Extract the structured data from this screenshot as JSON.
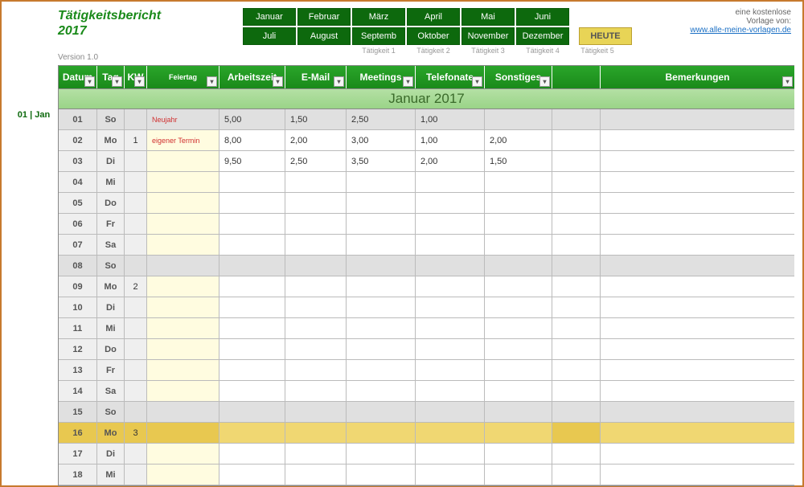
{
  "title_line1": "Tätigkeitsbericht",
  "title_line2": "2017",
  "version": "Version 1.0",
  "months_row1": [
    "Januar",
    "Februar",
    "März",
    "April",
    "Mai",
    "Juni"
  ],
  "months_row2": [
    "Juli",
    "August",
    "Septemb",
    "Oktober",
    "November",
    "Dezember"
  ],
  "heute_label": "HEUTE",
  "tatigkeit_labels": [
    "Tätigkeit 1",
    "Tätigkeit 2",
    "Tätigkeit 3",
    "Tätigkeit 4",
    "Tätigkeit 5"
  ],
  "credit_line1": "eine kostenlose",
  "credit_line2": "Vorlage von:",
  "credit_link": "www.alle-meine-vorlagen.de",
  "side_label": "01 | Jan",
  "columns": {
    "datum": "Datum",
    "tag": "Tag",
    "kw": "KW",
    "feiertag": "Feiertag",
    "arbeitszeit": "Arbeitszeit",
    "email": "E-Mail",
    "meetings": "Meetings",
    "telefonate": "Telefonate",
    "sonstiges": "Sonstiges",
    "bemerkungen": "Bemerkungen"
  },
  "month_title": "Januar 2017",
  "rows": [
    {
      "datum": "01",
      "tag": "So",
      "kw": "",
      "feiertag": "Neujahr",
      "arbeit": "5,00",
      "email": "1,50",
      "meet": "2,50",
      "tel": "1,00",
      "sonst": "",
      "bem": "",
      "type": "sunday"
    },
    {
      "datum": "02",
      "tag": "Mo",
      "kw": "1",
      "feiertag": "eigener Termin",
      "arbeit": "8,00",
      "email": "2,00",
      "meet": "3,00",
      "tel": "1,00",
      "sonst": "2,00",
      "bem": "",
      "type": "normal"
    },
    {
      "datum": "03",
      "tag": "Di",
      "kw": "",
      "feiertag": "",
      "arbeit": "9,50",
      "email": "2,50",
      "meet": "3,50",
      "tel": "2,00",
      "sonst": "1,50",
      "bem": "",
      "type": "normal"
    },
    {
      "datum": "04",
      "tag": "Mi",
      "kw": "",
      "feiertag": "",
      "arbeit": "",
      "email": "",
      "meet": "",
      "tel": "",
      "sonst": "",
      "bem": "",
      "type": "normal"
    },
    {
      "datum": "05",
      "tag": "Do",
      "kw": "",
      "feiertag": "",
      "arbeit": "",
      "email": "",
      "meet": "",
      "tel": "",
      "sonst": "",
      "bem": "",
      "type": "normal"
    },
    {
      "datum": "06",
      "tag": "Fr",
      "kw": "",
      "feiertag": "",
      "arbeit": "",
      "email": "",
      "meet": "",
      "tel": "",
      "sonst": "",
      "bem": "",
      "type": "normal"
    },
    {
      "datum": "07",
      "tag": "Sa",
      "kw": "",
      "feiertag": "",
      "arbeit": "",
      "email": "",
      "meet": "",
      "tel": "",
      "sonst": "",
      "bem": "",
      "type": "normal"
    },
    {
      "datum": "08",
      "tag": "So",
      "kw": "",
      "feiertag": "",
      "arbeit": "",
      "email": "",
      "meet": "",
      "tel": "",
      "sonst": "",
      "bem": "",
      "type": "sunday"
    },
    {
      "datum": "09",
      "tag": "Mo",
      "kw": "2",
      "feiertag": "",
      "arbeit": "",
      "email": "",
      "meet": "",
      "tel": "",
      "sonst": "",
      "bem": "",
      "type": "normal"
    },
    {
      "datum": "10",
      "tag": "Di",
      "kw": "",
      "feiertag": "",
      "arbeit": "",
      "email": "",
      "meet": "",
      "tel": "",
      "sonst": "",
      "bem": "",
      "type": "normal"
    },
    {
      "datum": "11",
      "tag": "Mi",
      "kw": "",
      "feiertag": "",
      "arbeit": "",
      "email": "",
      "meet": "",
      "tel": "",
      "sonst": "",
      "bem": "",
      "type": "normal"
    },
    {
      "datum": "12",
      "tag": "Do",
      "kw": "",
      "feiertag": "",
      "arbeit": "",
      "email": "",
      "meet": "",
      "tel": "",
      "sonst": "",
      "bem": "",
      "type": "normal"
    },
    {
      "datum": "13",
      "tag": "Fr",
      "kw": "",
      "feiertag": "",
      "arbeit": "",
      "email": "",
      "meet": "",
      "tel": "",
      "sonst": "",
      "bem": "",
      "type": "normal"
    },
    {
      "datum": "14",
      "tag": "Sa",
      "kw": "",
      "feiertag": "",
      "arbeit": "",
      "email": "",
      "meet": "",
      "tel": "",
      "sonst": "",
      "bem": "",
      "type": "normal"
    },
    {
      "datum": "15",
      "tag": "So",
      "kw": "",
      "feiertag": "",
      "arbeit": "",
      "email": "",
      "meet": "",
      "tel": "",
      "sonst": "",
      "bem": "",
      "type": "sunday"
    },
    {
      "datum": "16",
      "tag": "Mo",
      "kw": "3",
      "feiertag": "",
      "arbeit": "",
      "email": "",
      "meet": "",
      "tel": "",
      "sonst": "",
      "bem": "",
      "type": "highlight"
    },
    {
      "datum": "17",
      "tag": "Di",
      "kw": "",
      "feiertag": "",
      "arbeit": "",
      "email": "",
      "meet": "",
      "tel": "",
      "sonst": "",
      "bem": "",
      "type": "normal"
    },
    {
      "datum": "18",
      "tag": "Mi",
      "kw": "",
      "feiertag": "",
      "arbeit": "",
      "email": "",
      "meet": "",
      "tel": "",
      "sonst": "",
      "bem": "",
      "type": "normal"
    }
  ]
}
